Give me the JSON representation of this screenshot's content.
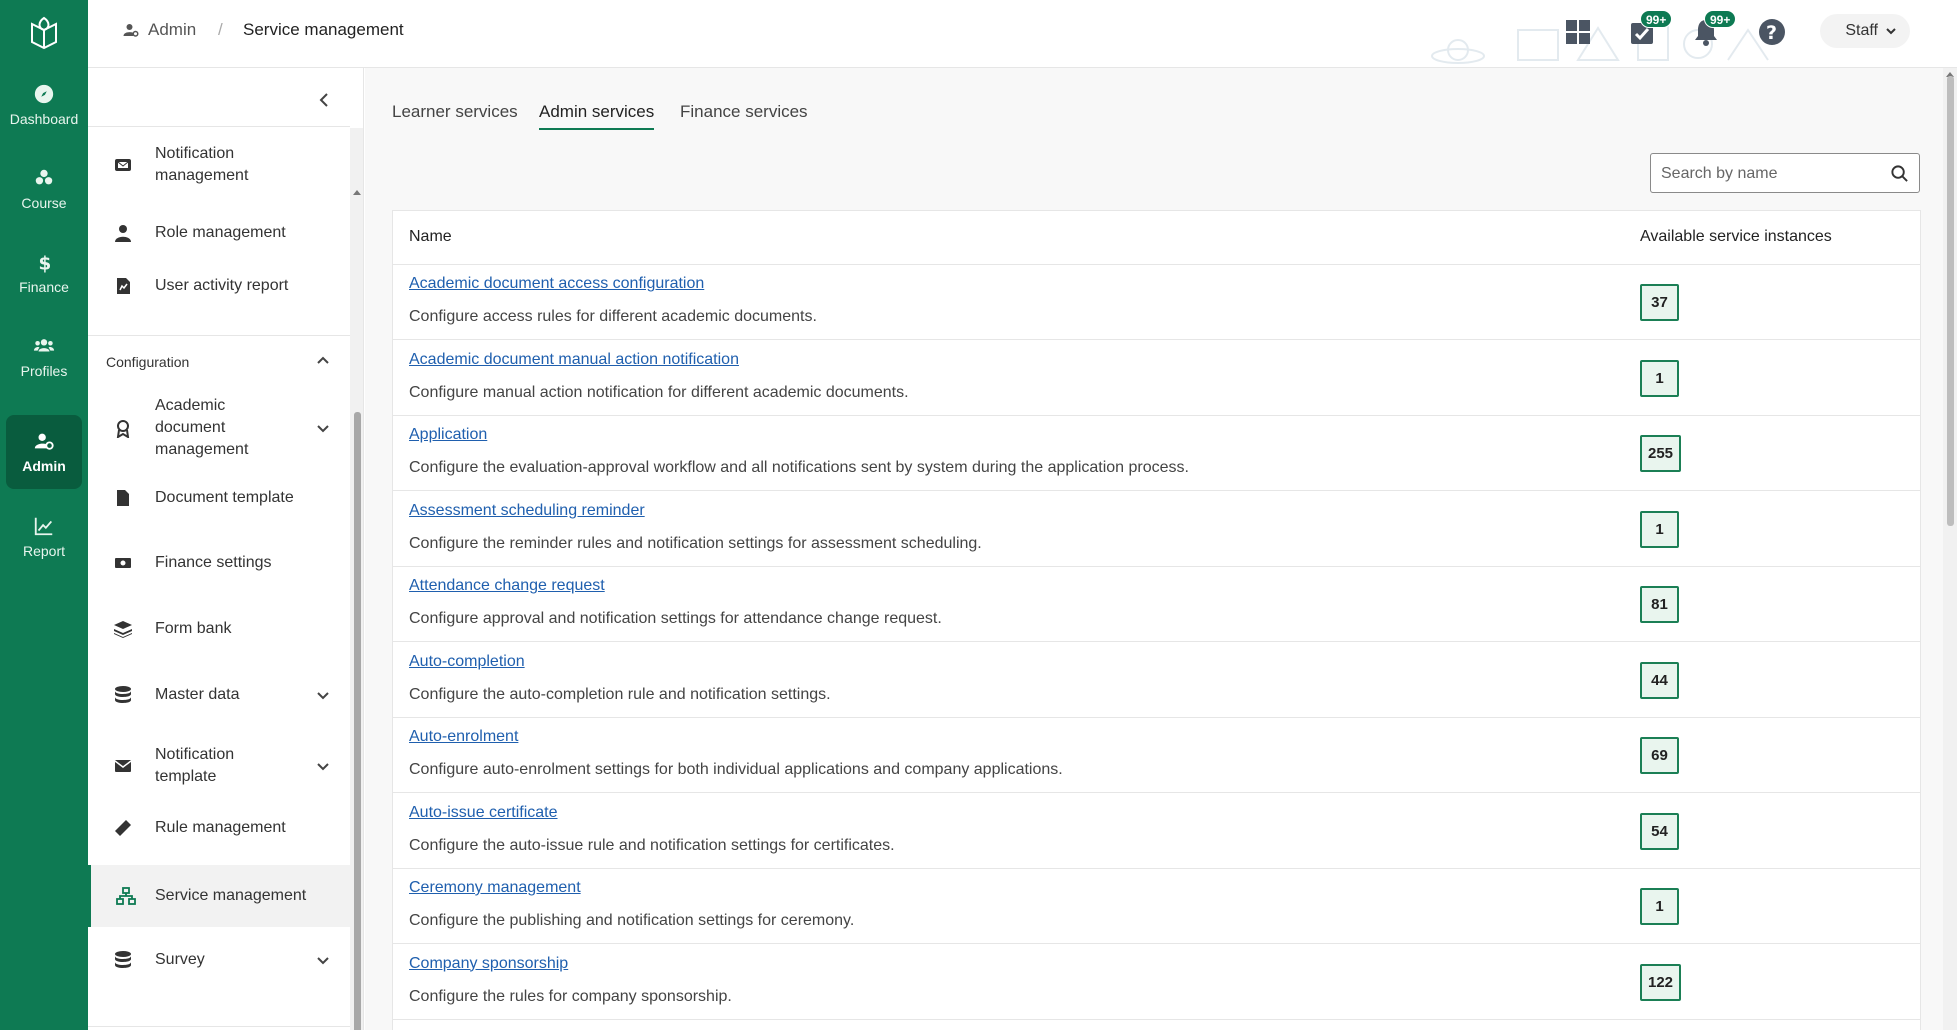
{
  "rail": {
    "logo_icon": "open-book-leaf-icon",
    "items": [
      {
        "label": "Dashboard",
        "icon": "compass-icon"
      },
      {
        "label": "Course",
        "icon": "course-icon"
      },
      {
        "label": "Finance",
        "icon": "dollar-icon"
      },
      {
        "label": "Profiles",
        "icon": "users-icon"
      },
      {
        "label": "Admin",
        "icon": "user-cog-icon"
      },
      {
        "label": "Report",
        "icon": "chart-icon"
      }
    ],
    "active": "Admin"
  },
  "header": {
    "breadcrumb": [
      {
        "label": "Admin"
      },
      {
        "label": "Service management"
      }
    ],
    "separator": "/",
    "tasks_badge": "99+",
    "notifications_badge": "99+",
    "user_label": "Staff"
  },
  "sidebar": {
    "items_top": [
      {
        "label": "Notification management",
        "icon": "notification-icon"
      },
      {
        "label": "Role management",
        "icon": "role-icon"
      },
      {
        "label": "User activity report",
        "icon": "report-icon"
      }
    ],
    "section": "Configuration",
    "items_config": [
      {
        "label": "Academic document management",
        "icon": "award-icon",
        "expandable": true
      },
      {
        "label": "Document template",
        "icon": "document-icon"
      },
      {
        "label": "Finance settings",
        "icon": "money-icon"
      },
      {
        "label": "Form bank",
        "icon": "layers-icon"
      },
      {
        "label": "Master data",
        "icon": "database-icon",
        "expandable": true
      },
      {
        "label": "Notification template",
        "icon": "envelope-icon",
        "expandable": true
      },
      {
        "label": "Rule management",
        "icon": "ruler-icon"
      },
      {
        "label": "Service management",
        "icon": "network-icon",
        "active": true
      },
      {
        "label": "Survey",
        "icon": "survey-icon",
        "expandable": true
      }
    ]
  },
  "main": {
    "tabs": [
      {
        "label": "Learner services"
      },
      {
        "label": "Admin services",
        "active": true
      },
      {
        "label": "Finance services"
      }
    ],
    "search_placeholder": "Search by name",
    "columns": [
      "Name",
      "Available service instances"
    ],
    "rows": [
      {
        "name": "Academic document access configuration",
        "desc": "Configure access rules for different academic documents.",
        "count": "37"
      },
      {
        "name": "Academic document manual action notification",
        "desc": "Configure manual action notification for different academic documents.",
        "count": "1"
      },
      {
        "name": "Application",
        "desc": "Configure the evaluation-approval workflow and all notifications sent by system during the application process.",
        "count": "255"
      },
      {
        "name": "Assessment scheduling reminder",
        "desc": "Configure the reminder rules and notification settings for assessment scheduling.",
        "count": "1"
      },
      {
        "name": "Attendance change request",
        "desc": "Configure approval and notification settings for attendance change request.",
        "count": "81"
      },
      {
        "name": "Auto-completion",
        "desc": "Configure the auto-completion rule and notification settings.",
        "count": "44"
      },
      {
        "name": "Auto-enrolment",
        "desc": "Configure auto-enrolment settings for both individual applications and company applications.",
        "count": "69"
      },
      {
        "name": "Auto-issue certificate",
        "desc": "Configure the auto-issue rule and notification settings for certificates.",
        "count": "54"
      },
      {
        "name": "Ceremony management",
        "desc": "Configure the publishing and notification settings for ceremony.",
        "count": "1"
      },
      {
        "name": "Company sponsorship",
        "desc": "Configure the rules for company sponsorship.",
        "count": "122"
      }
    ]
  },
  "colors": {
    "brand": "#0e7a53",
    "link": "#1f5fae",
    "badge_bg": "#e9f5ee"
  }
}
